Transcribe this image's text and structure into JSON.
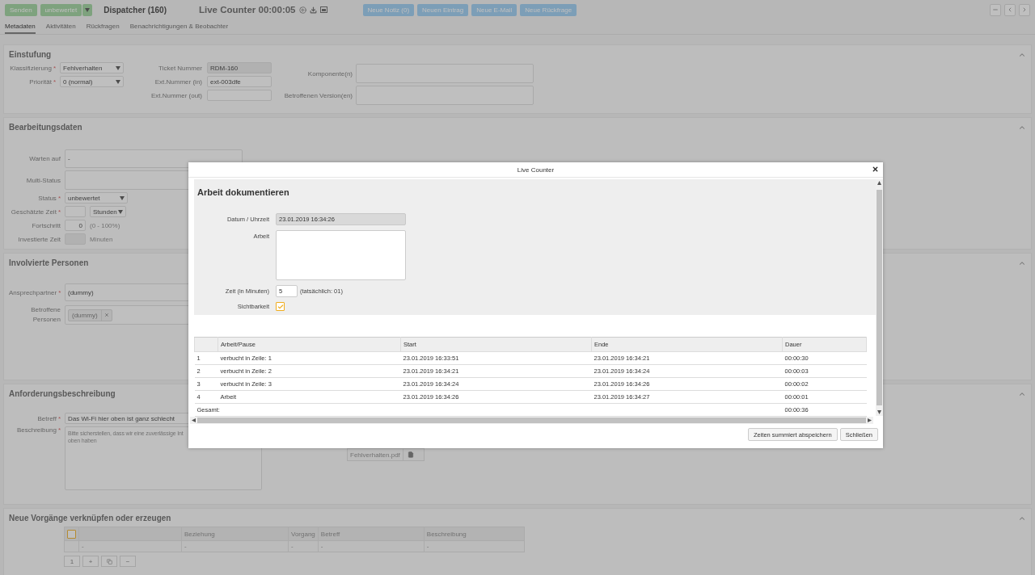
{
  "toolbar": {
    "send_button": "Senden",
    "status_button": "unbewertet",
    "title": "Dispatcher (160)",
    "counter": "Live Counter 00:00:05",
    "actions": [
      "Neue Notiz (0)",
      "Neuen Eintrag",
      "Neue E-Mail",
      "Neue Rückfrage"
    ]
  },
  "tabs": [
    {
      "label": "Metadaten",
      "selected": true
    },
    {
      "label": "Aktivitäten",
      "selected": false
    },
    {
      "label": "Rückfragen",
      "selected": false
    },
    {
      "label": "Benachrichtigungen & Beobachter",
      "selected": false
    }
  ],
  "classification": {
    "title": "Einstufung",
    "selects": [
      {
        "label": "Klassifizierung",
        "required_mark": "*",
        "value": "Fehlverhalten"
      },
      {
        "label": "Priorität",
        "required_mark": "*",
        "value": "0 (normal)"
      }
    ],
    "numbers": [
      {
        "label": "Ticket Nummer",
        "value": "RDM-160",
        "disabled": true
      },
      {
        "label": "Ext.Nummer (in)",
        "value": "ext-003dfe",
        "disabled": false
      },
      {
        "label": "Ext.Nummer (out)",
        "disabled": false
      }
    ],
    "multi": [
      {
        "label": "Komponente(n)"
      },
      {
        "label": "Betroffenen Version(en)"
      }
    ]
  },
  "processing": {
    "title": "Bearbeitungsdaten",
    "rows": [
      {
        "kind": "wide",
        "label": "Warten auf",
        "value": "-"
      },
      {
        "kind": "wide",
        "label": "Multi-Status"
      },
      {
        "kind": "select",
        "label": "Status",
        "required_mark": "*",
        "value": "unbewertet"
      },
      {
        "kind": "duration",
        "label": "Geschätzte Zeit",
        "required_mark": "*",
        "unit": "Stunden"
      },
      {
        "kind": "number",
        "label": "Fortschritt",
        "value": "0",
        "hint": "(0 - 100%)"
      },
      {
        "kind": "readonly",
        "label": "Investierte Zeit",
        "hint": "Minuten"
      }
    ]
  },
  "persons": {
    "title": "Involvierte Personen",
    "contact": {
      "label": "Ansprechpartner",
      "required_mark": "*",
      "value": "(dummy)"
    },
    "affected": {
      "label": "Betroffene Personen",
      "tags": [
        "(dummy)"
      ]
    }
  },
  "requirements": {
    "title": "Anforderungsbeschreibung",
    "subject": {
      "label": "Betreff",
      "required_mark": "*",
      "value": "Das Wi-Fi hier oben ist ganz schlecht"
    },
    "description": {
      "label": "Beschreibung",
      "required_mark": "*",
      "lines": [
        "Bitte sicherstellen, dass wir eine zuverlässige Int",
        "oben haben"
      ]
    },
    "attachment": "Fehlverhalten.pdf"
  },
  "links": {
    "title": "Neue Vorgänge verknüpfen oder erzeugen",
    "select_all_checked": false,
    "columns": [
      "",
      "Beziehung",
      "Vorgang",
      "Betreff",
      "Beschreibung"
    ],
    "rows": [
      [
        "-",
        "-",
        "-",
        "-",
        "-"
      ]
    ],
    "pager": {
      "page": "1",
      "add": "+",
      "remove": "−"
    }
  },
  "dialog": {
    "title": "Live Counter",
    "heading": "Arbeit dokumentieren",
    "date": {
      "label": "Datum / Uhrzeit",
      "value": "23.01.2019 16:34:26"
    },
    "work": {
      "label": "Arbeit"
    },
    "minutes": {
      "label": "Zeit (in Minuten)",
      "value": "5",
      "hint": "(tatsächlich: 01)"
    },
    "visibility": {
      "label": "Sichtbarkeit",
      "checked": true
    },
    "table": {
      "columns": [
        "Arbeit/Pause",
        "Start",
        "Ende",
        "Dauer"
      ],
      "rows": [
        {
          "index": "1",
          "activity": "verbucht in Zeile: 1",
          "start": "23.01.2019 16:33:51",
          "end": "23.01.2019 16:34:21",
          "duration": "00:00:30"
        },
        {
          "index": "2",
          "activity": "verbucht in Zeile: 2",
          "start": "23.01.2019 16:34:21",
          "end": "23.01.2019 16:34:24",
          "duration": "00:00:03"
        },
        {
          "index": "3",
          "activity": "verbucht in Zeile: 3",
          "start": "23.01.2019 16:34:24",
          "end": "23.01.2019 16:34:26",
          "duration": "00:00:02"
        },
        {
          "index": "4",
          "activity": "Arbeit",
          "start": "23.01.2019 16:34:26",
          "end": "23.01.2019 16:34:27",
          "duration": "00:00:01"
        }
      ],
      "total": {
        "label": "Gesamt:",
        "value": "00:00:36"
      }
    },
    "buttons": [
      "Zeiten summiert abspeichern",
      "Schließen"
    ]
  }
}
